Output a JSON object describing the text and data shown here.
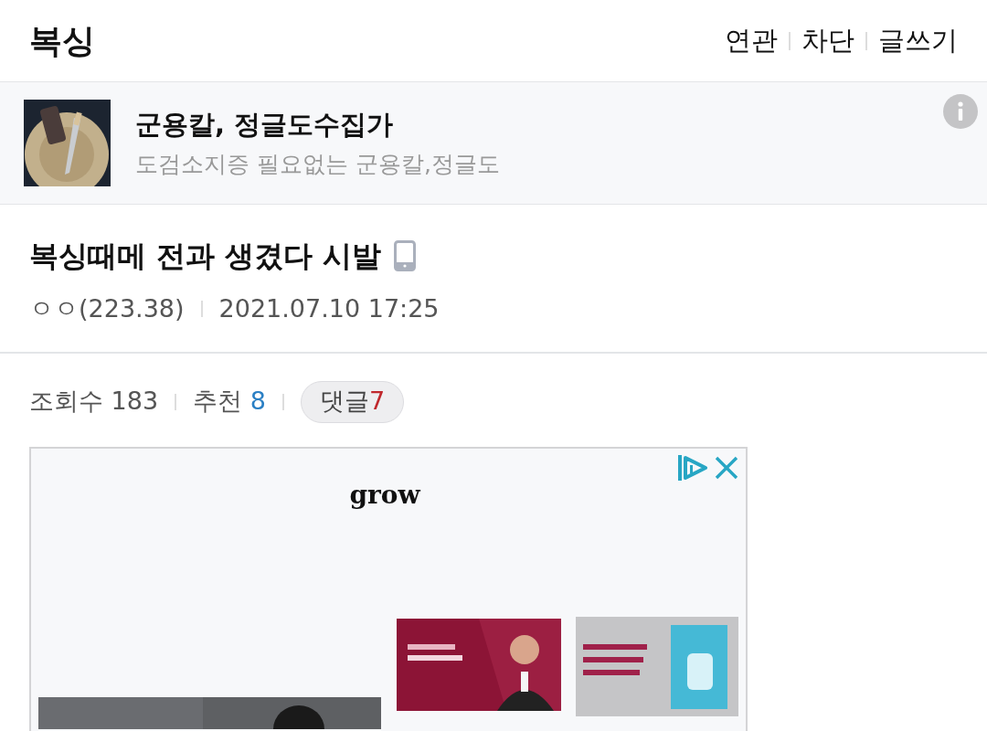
{
  "header": {
    "title": "복싱",
    "links": [
      "연관",
      "차단",
      "글쓰기"
    ]
  },
  "gallery": {
    "name": "군용칼, 정글도수집가",
    "description": "도검소지증 필요없는 군용칼,정글도"
  },
  "post": {
    "title": "복싱때메 전과 생겼다 시발",
    "author": "ㅇㅇ(223.38)",
    "date": "2021.07.10 17:25"
  },
  "stats": {
    "views_label": "조회수",
    "views": "183",
    "likes_label": "추천",
    "likes": "8",
    "comments_label": "댓글",
    "comments": "7"
  },
  "ad": {
    "logo": "grow"
  }
}
